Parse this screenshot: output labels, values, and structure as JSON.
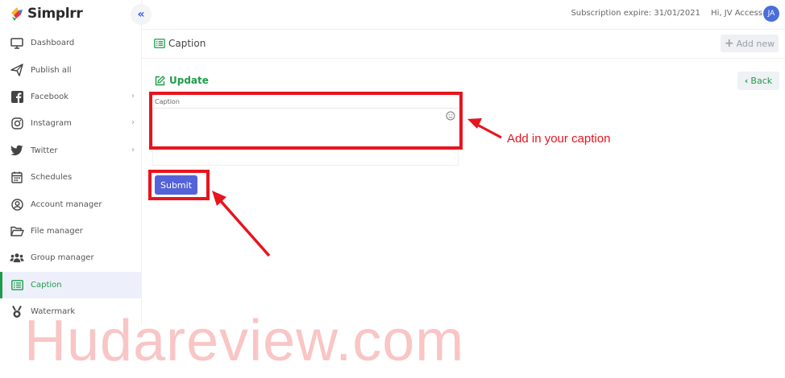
{
  "app": {
    "name": "Simplrr",
    "collapse_icon": "double-chevron-left-icon"
  },
  "topbar": {
    "subscription": "Subscription expire: 31/01/2021",
    "greeting": "Hi, JV Access",
    "avatar_initials": "JA"
  },
  "sidebar": {
    "items": [
      {
        "label": "Dashboard",
        "icon": "monitor-icon"
      },
      {
        "label": "Publish all",
        "icon": "paper-plane-icon"
      },
      {
        "label": "Facebook",
        "icon": "facebook-icon",
        "expandable": true
      },
      {
        "label": "Instagram",
        "icon": "instagram-icon",
        "expandable": true
      },
      {
        "label": "Twitter",
        "icon": "twitter-icon",
        "expandable": true
      },
      {
        "label": "Schedules",
        "icon": "calendar-icon"
      },
      {
        "label": "Account manager",
        "icon": "user-circle-icon"
      },
      {
        "label": "File manager",
        "icon": "folder-open-icon"
      },
      {
        "label": "Group manager",
        "icon": "users-icon"
      },
      {
        "label": "Caption",
        "icon": "list-alt-icon",
        "active": true
      },
      {
        "label": "Watermark",
        "icon": "medal-icon"
      }
    ]
  },
  "page": {
    "title": "Caption",
    "add_new_label": "Add new",
    "update_title": "Update",
    "back_label": "Back",
    "caption_label": "Caption",
    "caption_value": "",
    "submit_label": "Submit"
  },
  "annotations": {
    "caption_hint": "Add in your caption",
    "watermark": "Hudareview.com",
    "color": "#e8141e"
  },
  "colors": {
    "accent_green": "#1f9b4b",
    "primary_blue": "#5563d8",
    "avatar_blue": "#4a6fd8"
  }
}
